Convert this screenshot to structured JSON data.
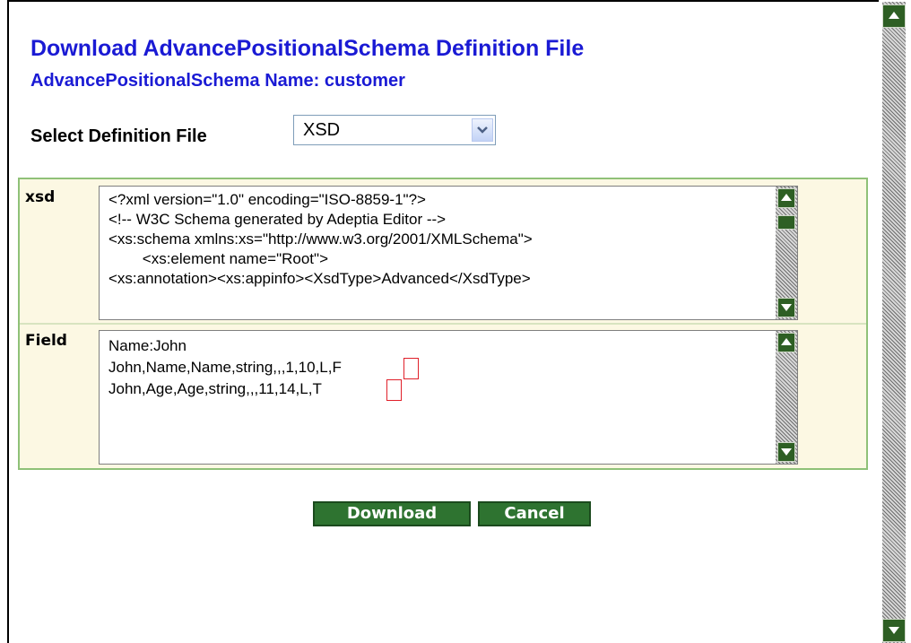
{
  "header": {
    "title": "Download AdvancePositionalSchema Definition File",
    "subtitle": "AdvancePositionalSchema Name: customer"
  },
  "selector": {
    "label": "Select Definition File",
    "value": "XSD"
  },
  "definition": {
    "xsd_label": "xsd",
    "xsd_lines": [
      "<?xml version=\"1.0\" encoding=\"ISO-8859-1\"?>",
      "<!-- W3C Schema generated by Adeptia Editor -->",
      "<xs:schema xmlns:xs=\"http://www.w3.org/2001/XMLSchema\">",
      "        <xs:element name=\"Root\">",
      "<xs:annotation><xs:appinfo><XsdType>Advanced</XsdType>"
    ],
    "field_label": "Field",
    "field_lines": [
      "Name:John",
      "John,Name,Name,string,,,1,10,L,F",
      "John,Age,Age,string,,,11,14,L,T"
    ]
  },
  "buttons": {
    "download": "Download",
    "cancel": "Cancel"
  },
  "colors": {
    "heading": "#1a1ad4",
    "button": "#2e7330",
    "panel_border": "#8fc178",
    "panel_bg": "#fcf8e3",
    "highlight": "#e0202a"
  },
  "icons": [
    "chevron-down-icon",
    "scroll-up-icon",
    "scroll-down-icon"
  ]
}
